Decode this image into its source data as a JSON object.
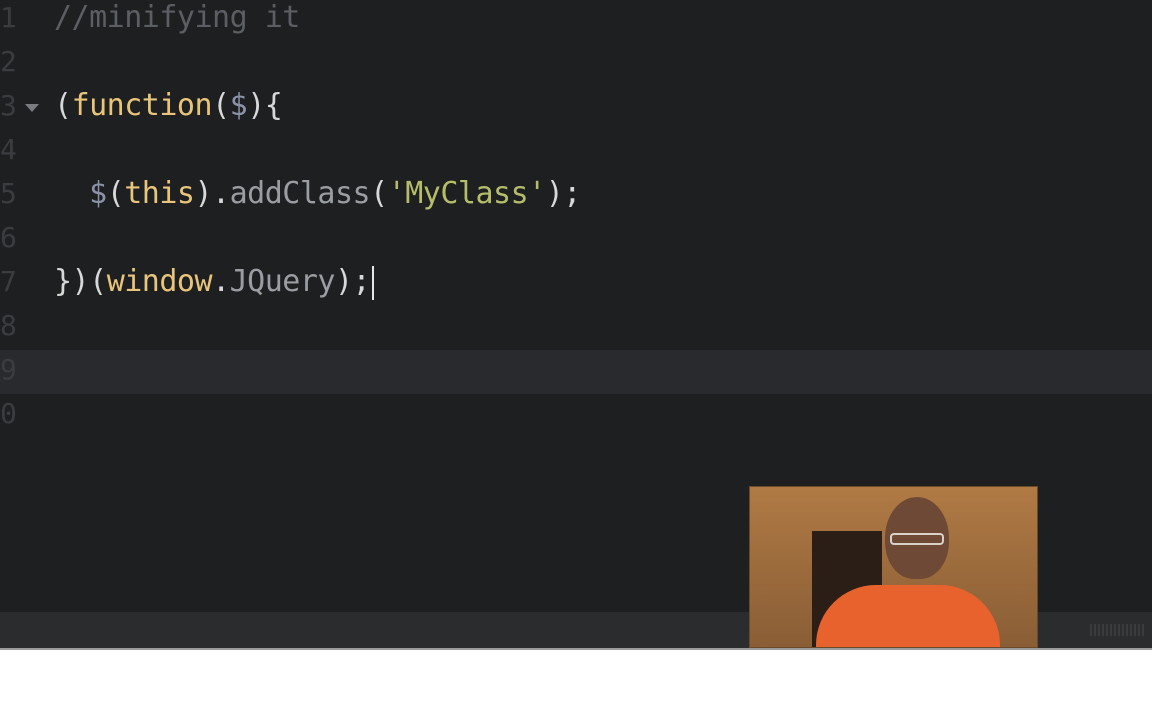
{
  "editor": {
    "lines": [
      {
        "number": "1",
        "segments": [
          {
            "text": "//minifying it",
            "cls": "comment"
          }
        ]
      },
      {
        "number": "2",
        "segments": []
      },
      {
        "number": "3",
        "fold": true,
        "segments": [
          {
            "text": "(",
            "cls": "punct"
          },
          {
            "text": "function",
            "cls": "kw"
          },
          {
            "text": "(",
            "cls": "punct"
          },
          {
            "text": "$",
            "cls": "var"
          },
          {
            "text": "){",
            "cls": "punct"
          }
        ]
      },
      {
        "number": "4",
        "segments": []
      },
      {
        "number": "5",
        "segments": [
          {
            "text": "  ",
            "cls": "punct"
          },
          {
            "text": "$",
            "cls": "var"
          },
          {
            "text": "(",
            "cls": "punct"
          },
          {
            "text": "this",
            "cls": "kw"
          },
          {
            "text": ").",
            "cls": "punct"
          },
          {
            "text": "addClass",
            "cls": "method"
          },
          {
            "text": "(",
            "cls": "punct"
          },
          {
            "text": "'MyClass'",
            "cls": "str"
          },
          {
            "text": ");",
            "cls": "punct"
          }
        ]
      },
      {
        "number": "6",
        "segments": []
      },
      {
        "number": "7",
        "cursor": true,
        "segments": [
          {
            "text": "})(",
            "cls": "punct"
          },
          {
            "text": "window",
            "cls": "kw"
          },
          {
            "text": ".",
            "cls": "punct"
          },
          {
            "text": "JQuery",
            "cls": "method"
          },
          {
            "text": ");",
            "cls": "punct"
          }
        ]
      },
      {
        "number": "8",
        "segments": []
      },
      {
        "number": "9",
        "current": true,
        "segments": []
      },
      {
        "number": "0",
        "segments": []
      }
    ]
  },
  "colors": {
    "background": "#1d1f21",
    "keyword": "#e8c57a",
    "string": "#b5bd68",
    "comment": "#5b5e63"
  },
  "webcam": {
    "icon": "presenter-webcam-overlay"
  }
}
